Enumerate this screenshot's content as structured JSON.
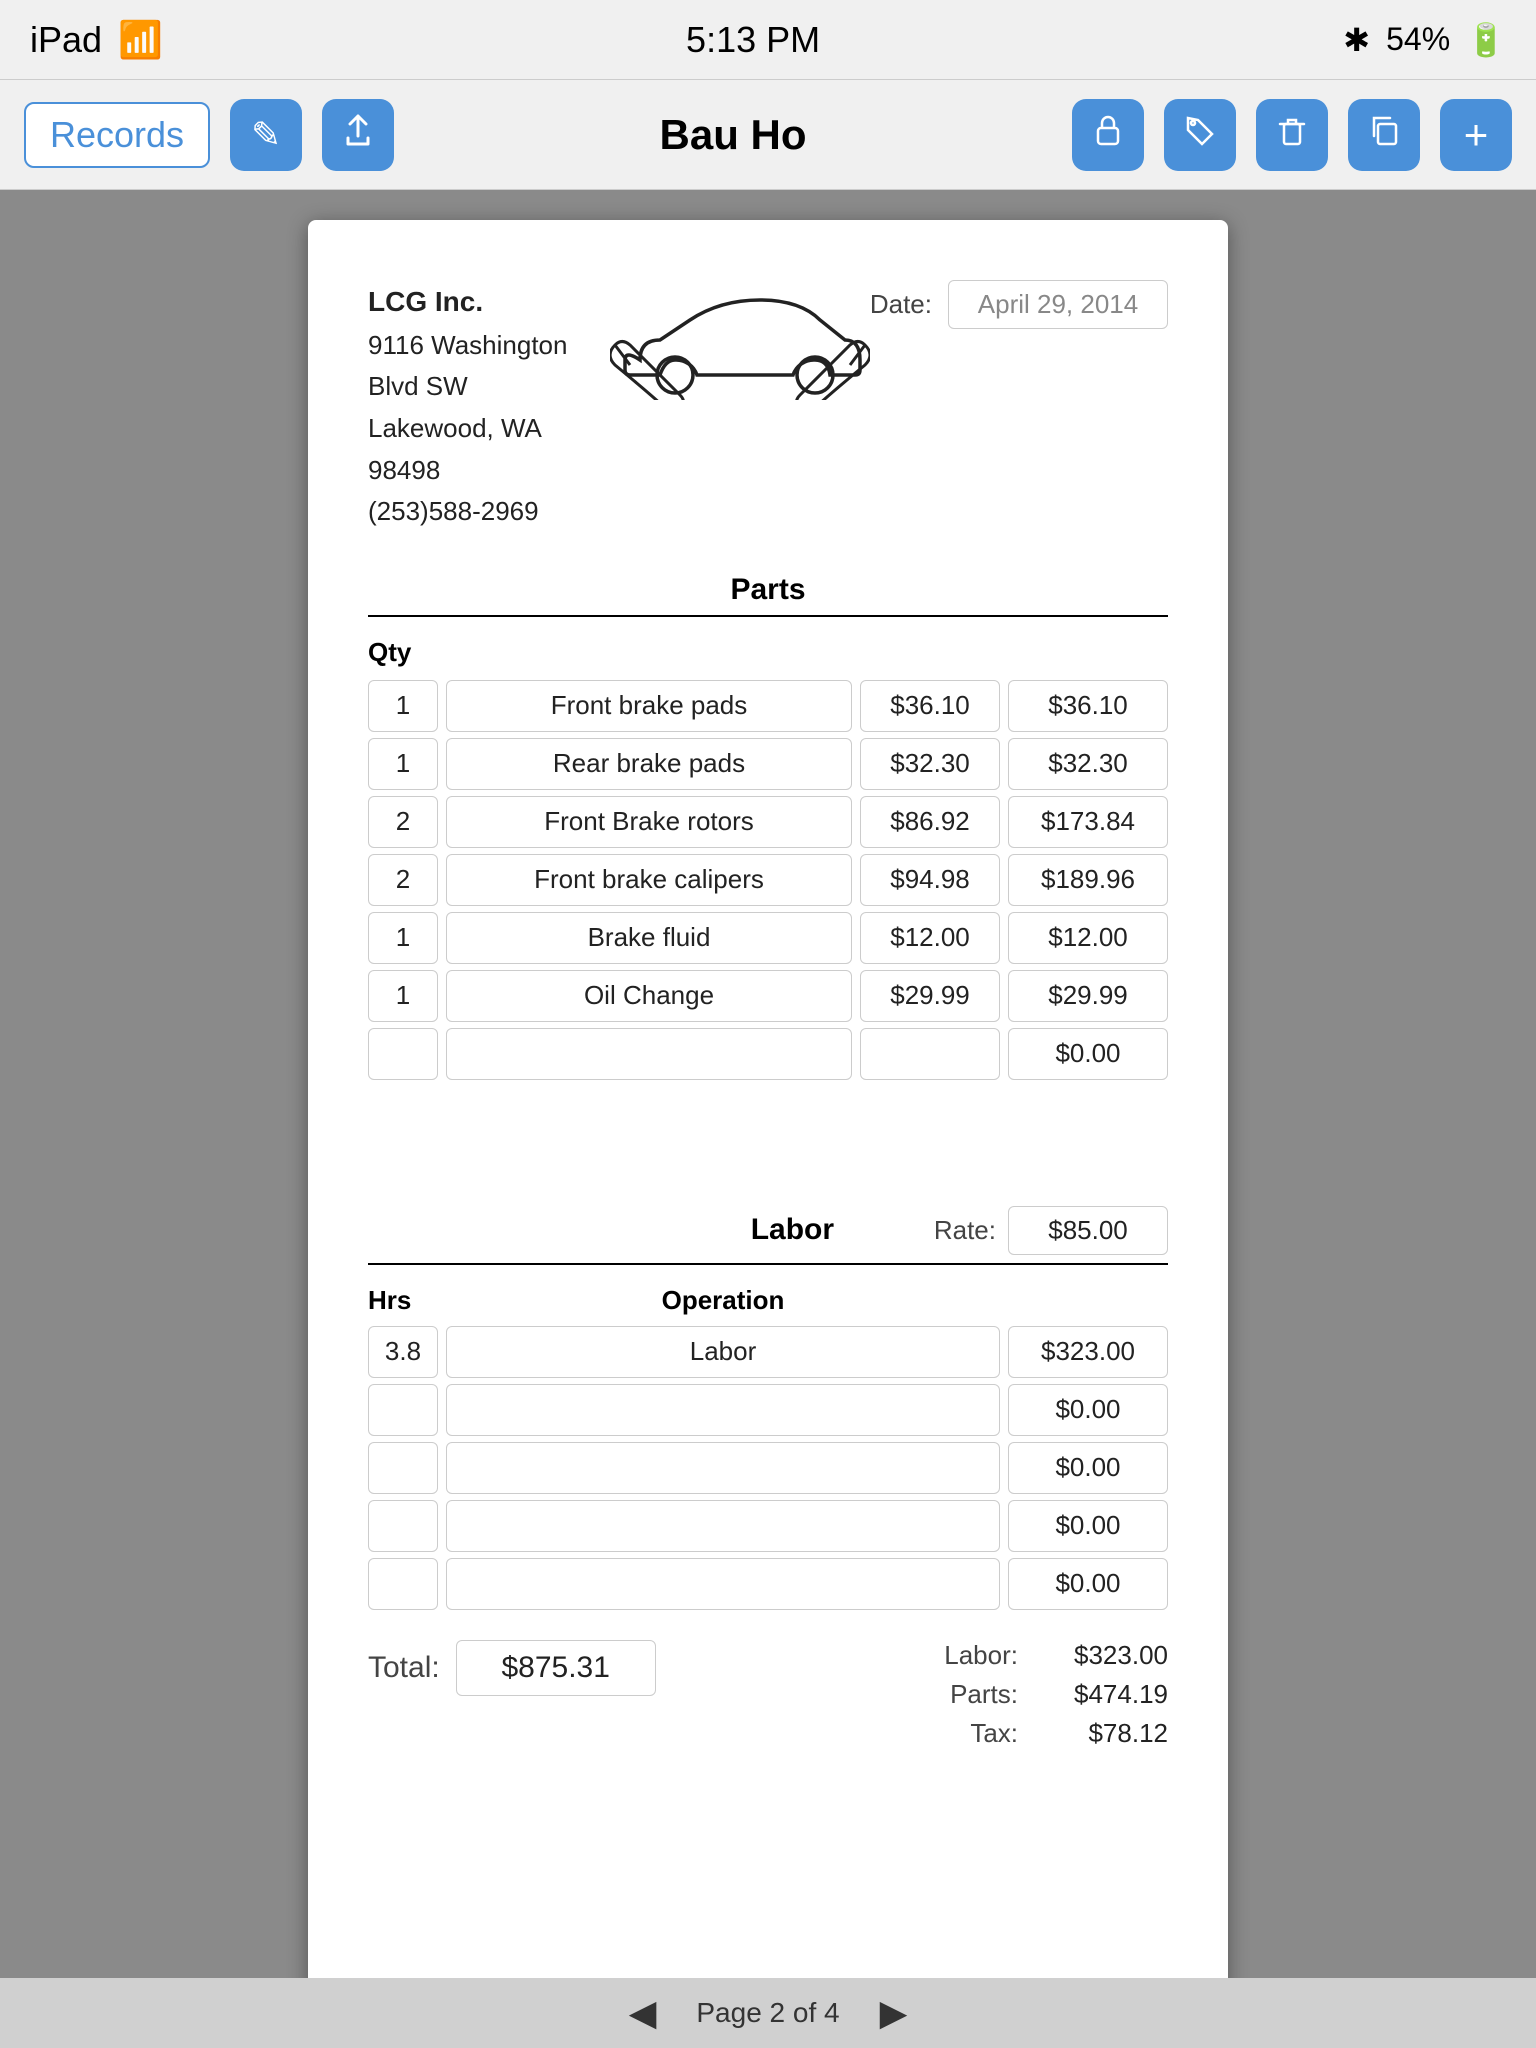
{
  "statusBar": {
    "device": "iPad",
    "wifi": "WiFi",
    "time": "5:13 PM",
    "bluetooth": "BT",
    "battery": "54%"
  },
  "toolbar": {
    "recordsLabel": "Records",
    "title": "Bau Ho",
    "icons": {
      "edit": "✎",
      "share": "⬆",
      "lock": "🔒",
      "tag": "🏷",
      "trash": "🗑",
      "copy": "📋",
      "add": "+"
    }
  },
  "invoice": {
    "company": {
      "name": "LCG Inc.",
      "address1": "9116 Washington Blvd SW",
      "address2": "Lakewood, WA  98498",
      "phone": "(253)588-2969"
    },
    "dateLabel": "Date:",
    "dateValue": "April 29, 2014",
    "sections": {
      "parts": {
        "title": "Parts",
        "qtyHeader": "Qty",
        "items": [
          {
            "qty": "1",
            "desc": "Front brake pads",
            "unit": "$36.10",
            "total": "$36.10"
          },
          {
            "qty": "1",
            "desc": "Rear brake pads",
            "unit": "$32.30",
            "total": "$32.30"
          },
          {
            "qty": "2",
            "desc": "Front Brake rotors",
            "unit": "$86.92",
            "total": "$173.84"
          },
          {
            "qty": "2",
            "desc": "Front brake calipers",
            "unit": "$94.98",
            "total": "$189.96"
          },
          {
            "qty": "1",
            "desc": "Brake fluid",
            "unit": "$12.00",
            "total": "$12.00"
          },
          {
            "qty": "1",
            "desc": "Oil Change",
            "unit": "$29.99",
            "total": "$29.99"
          },
          {
            "qty": "",
            "desc": "",
            "unit": "",
            "total": "$0.00"
          }
        ]
      },
      "labor": {
        "title": "Labor",
        "rateLabel": "Rate:",
        "rateValue": "$85.00",
        "hrsHeader": "Hrs",
        "opHeader": "Operation",
        "items": [
          {
            "hrs": "3.8",
            "op": "Labor",
            "amt": "$323.00"
          },
          {
            "hrs": "",
            "op": "",
            "amt": "$0.00"
          },
          {
            "hrs": "",
            "op": "",
            "amt": "$0.00"
          },
          {
            "hrs": "",
            "op": "",
            "amt": "$0.00"
          },
          {
            "hrs": "",
            "op": "",
            "amt": "$0.00"
          }
        ]
      }
    },
    "summary": {
      "totalLabel": "Total:",
      "totalValue": "$875.31",
      "laborLabel": "Labor:",
      "laborValue": "$323.00",
      "partsLabel": "Parts:",
      "partsValue": "$474.19",
      "taxLabel": "Tax:",
      "taxValue": "$78.12"
    }
  },
  "pagination": {
    "prev": "◀",
    "next": "▶",
    "label": "Page 2 of 4"
  }
}
